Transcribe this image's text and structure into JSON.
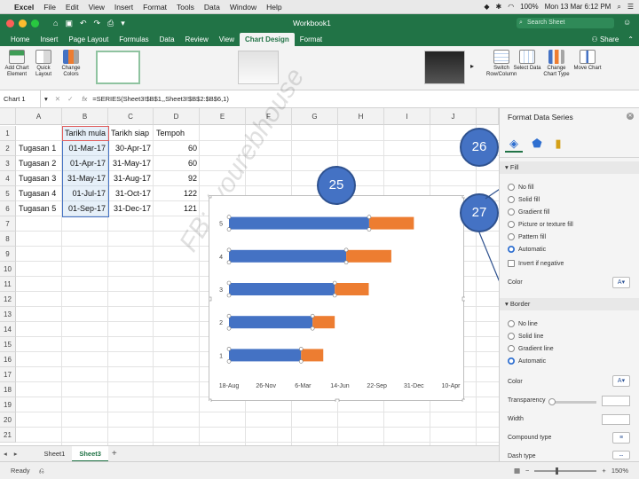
{
  "mac": {
    "menus": [
      "Excel",
      "File",
      "Edit",
      "View",
      "Insert",
      "Format",
      "Tools",
      "Data",
      "Window",
      "Help"
    ],
    "battery": "100%",
    "clock": "Mon 13 Mar  6:12 PM"
  },
  "window": {
    "title": "Workbook1",
    "search_placeholder": "Search Sheet"
  },
  "ribbon_tabs": [
    "Home",
    "Insert",
    "Page Layout",
    "Formulas",
    "Data",
    "Review",
    "View",
    "Chart Design",
    "Format"
  ],
  "active_tab": "Chart Design",
  "share_label": "Share",
  "ribbon": {
    "add_chart_element": "Add Chart Element",
    "quick_layout": "Quick Layout",
    "change_colors": "Change Colors",
    "switch_row_column": "Switch Row/Column",
    "select_data": "Select Data",
    "change_chart_type": "Change Chart Type",
    "move_chart": "Move Chart"
  },
  "formula_bar": {
    "name_box": "Chart 1",
    "fx": "fx",
    "formula": "=SERIES(Sheet3!$B$1,,Sheet3!$B$2:$B$6,1)"
  },
  "columns": [
    "A",
    "B",
    "C",
    "D",
    "E",
    "F",
    "G",
    "H",
    "I",
    "J"
  ],
  "rows": [
    "1",
    "2",
    "3",
    "4",
    "5",
    "6",
    "7",
    "8",
    "9",
    "10",
    "11",
    "12",
    "13",
    "14",
    "15",
    "16",
    "17",
    "18",
    "19",
    "20",
    "21"
  ],
  "table": {
    "headers": [
      "Tarikh mula",
      "Tarikh siap",
      "Tempoh"
    ],
    "rows": [
      [
        "Tugasan 1",
        "01-Mar-17",
        "30-Apr-17",
        "60"
      ],
      [
        "Tugasan 2",
        "01-Apr-17",
        "31-May-17",
        "60"
      ],
      [
        "Tugasan 3",
        "31-May-17",
        "31-Aug-17",
        "92"
      ],
      [
        "Tugasan 4",
        "01-Jul-17",
        "31-Oct-17",
        "122"
      ],
      [
        "Tugasan 5",
        "01-Sep-17",
        "31-Dec-17",
        "121"
      ]
    ]
  },
  "chart_data": {
    "type": "bar",
    "orientation": "horizontal",
    "stacked": true,
    "categories": [
      "1",
      "2",
      "3",
      "4",
      "5"
    ],
    "x_tick_labels": [
      "18-Aug",
      "26-Nov",
      "6-Mar",
      "14-Jun",
      "22-Sep",
      "31-Dec",
      "10-Apr"
    ],
    "xlim": [
      "2016-08-18",
      "2018-04-10"
    ],
    "series": [
      {
        "values": [
          "2017-03-01",
          "2017-04-01",
          "2017-05-31",
          "2017-07-01",
          "2017-09-01"
        ],
        "color": "#4472c4"
      },
      {
        "values": [
          60,
          60,
          92,
          122,
          121
        ],
        "color": "#ed7d31"
      }
    ],
    "grid": false,
    "legend": "none"
  },
  "callouts": [
    "25",
    "26",
    "27"
  ],
  "watermark": "FB: /yourebhouse",
  "pane": {
    "title": "Format Data Series",
    "fill_section": "Fill",
    "fill_options": [
      "No fill",
      "Solid fill",
      "Gradient fill",
      "Picture or texture fill",
      "Pattern fill",
      "Automatic"
    ],
    "fill_selected": "Automatic",
    "invert_if_negative": "Invert if negative",
    "color_label": "Color",
    "border_section": "Border",
    "border_options": [
      "No line",
      "Solid line",
      "Gradient line",
      "Automatic"
    ],
    "border_selected": "Automatic",
    "border_color_label": "Color",
    "transparency_label": "Transparency",
    "width_label": "Width",
    "compound_type_label": "Compound type",
    "dash_type_label": "Dash type"
  },
  "sheets": [
    "Sheet1",
    "Sheet3"
  ],
  "active_sheet": "Sheet3",
  "status": {
    "ready": "Ready",
    "zoom": "150%"
  }
}
